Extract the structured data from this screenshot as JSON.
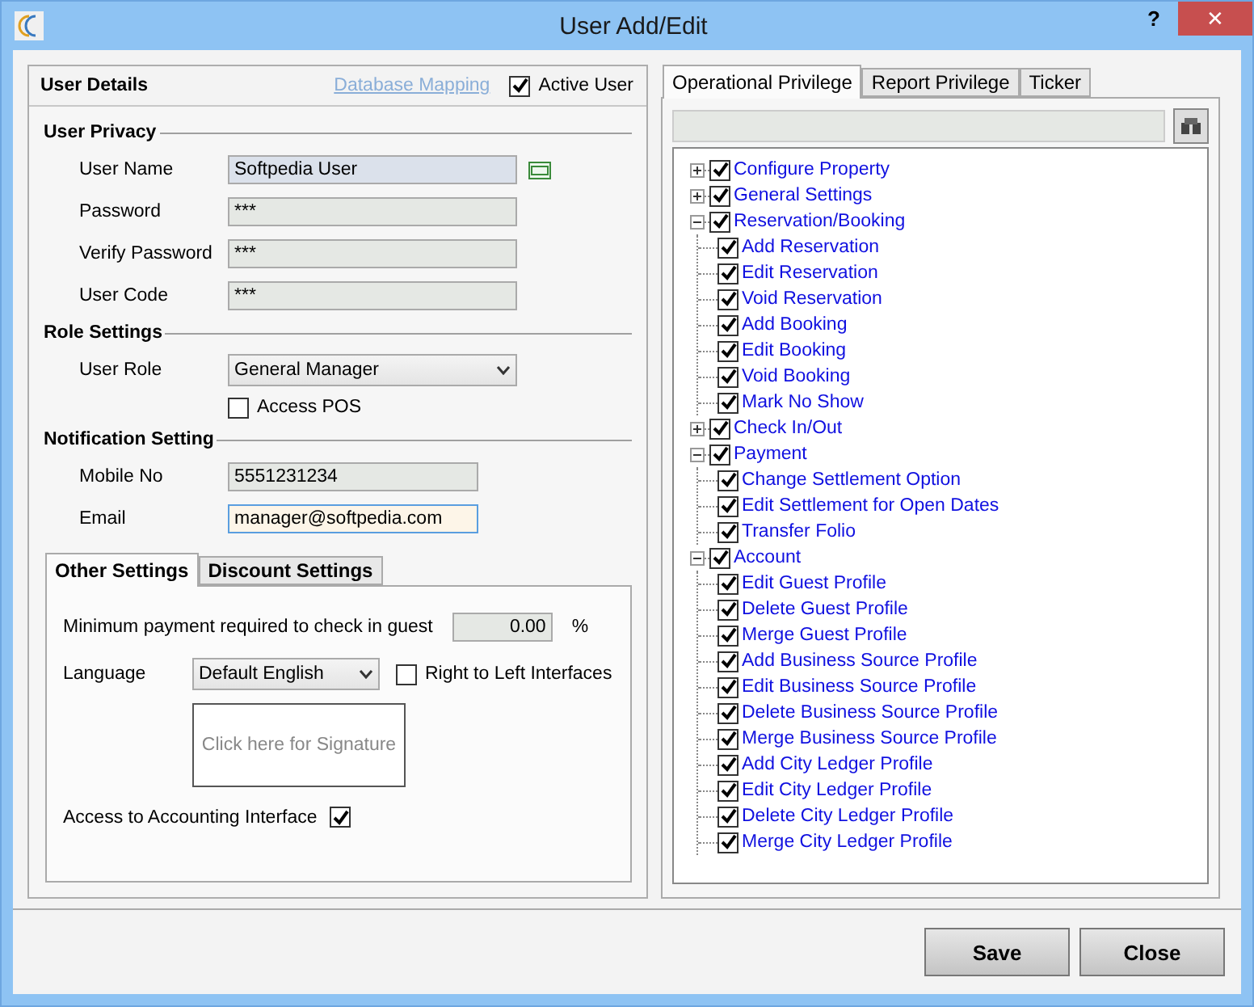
{
  "window": {
    "title": "User Add/Edit",
    "help": "?",
    "close": "✕"
  },
  "user_details": {
    "title": "User Details",
    "link": "Database Mapping",
    "active_user": {
      "label": "Active User",
      "checked": true
    }
  },
  "sections": [
    {
      "title": "User Privacy",
      "rows": [
        {
          "kind": "name",
          "label": "User Name",
          "value": "Softpedia User",
          "focused": false
        },
        {
          "kind": "input",
          "label": "Password",
          "value": "***",
          "focused": false
        },
        {
          "kind": "input",
          "label": "Verify Password",
          "value": "***",
          "focused": false
        },
        {
          "kind": "input",
          "label": "User Code",
          "value": "***",
          "focused": false
        }
      ]
    },
    {
      "title": "Role Settings",
      "rows": [
        {
          "kind": "select",
          "label": "User Role",
          "value": "General Manager"
        },
        {
          "kind": "checkbox",
          "label": "Access POS",
          "checked": false
        }
      ]
    },
    {
      "title": "Notification Setting",
      "rows": [
        {
          "kind": "input",
          "label": "Mobile No",
          "value": "5551231234",
          "focused": false
        },
        {
          "kind": "input",
          "label": "Email",
          "value": "manager@softpedia.com",
          "focused": true
        }
      ]
    }
  ],
  "settings_tabs": [
    {
      "label": "Other Settings",
      "selected": true
    },
    {
      "label": "Discount Settings",
      "selected": false
    }
  ],
  "other_settings": {
    "min_payment": {
      "label": "Minimum payment required to check in guest",
      "value": "0.00",
      "unit": "%"
    },
    "language": {
      "label": "Language",
      "value": "Default English"
    },
    "rtl": {
      "label": "Right to Left Interfaces",
      "checked": false
    },
    "signature": "Click here for Signature",
    "accounting": {
      "label": "Access to Accounting Interface",
      "checked": true
    }
  },
  "privilege_tabs": [
    {
      "label": "Operational Privilege",
      "selected": true
    },
    {
      "label": "Report Privilege",
      "selected": false
    },
    {
      "label": "Ticker",
      "selected": false
    }
  ],
  "tree": [
    {
      "label": "Configure Property",
      "checked": true,
      "expanded": false
    },
    {
      "label": "General Settings",
      "checked": true,
      "expanded": false
    },
    {
      "label": "Reservation/Booking",
      "checked": true,
      "expanded": true,
      "children": [
        {
          "label": "Add Reservation",
          "checked": true
        },
        {
          "label": "Edit Reservation",
          "checked": true
        },
        {
          "label": "Void Reservation",
          "checked": true
        },
        {
          "label": "Add Booking",
          "checked": true
        },
        {
          "label": "Edit Booking",
          "checked": true
        },
        {
          "label": "Void Booking",
          "checked": true
        },
        {
          "label": "Mark No Show",
          "checked": true
        }
      ]
    },
    {
      "label": "Check In/Out",
      "checked": true,
      "expanded": false
    },
    {
      "label": "Payment",
      "checked": true,
      "expanded": true,
      "children": [
        {
          "label": "Change Settlement Option",
          "checked": true
        },
        {
          "label": "Edit Settlement for Open Dates",
          "checked": true
        },
        {
          "label": "Transfer Folio",
          "checked": true
        }
      ]
    },
    {
      "label": "Account",
      "checked": true,
      "expanded": true,
      "children": [
        {
          "label": "Edit Guest Profile",
          "checked": true
        },
        {
          "label": "Delete Guest Profile",
          "checked": true
        },
        {
          "label": "Merge Guest Profile",
          "checked": true
        },
        {
          "label": "Add Business Source Profile",
          "checked": true
        },
        {
          "label": "Edit Business Source Profile",
          "checked": true
        },
        {
          "label": "Delete Business Source Profile",
          "checked": true
        },
        {
          "label": "Merge Business Source Profile",
          "checked": true
        },
        {
          "label": "Add City Ledger Profile",
          "checked": true
        },
        {
          "label": "Edit City Ledger Profile",
          "checked": true
        },
        {
          "label": "Delete City Ledger Profile",
          "checked": true
        },
        {
          "label": "Merge City Ledger Profile",
          "checked": true
        }
      ]
    }
  ],
  "buttons": [
    "Save",
    "Close"
  ]
}
